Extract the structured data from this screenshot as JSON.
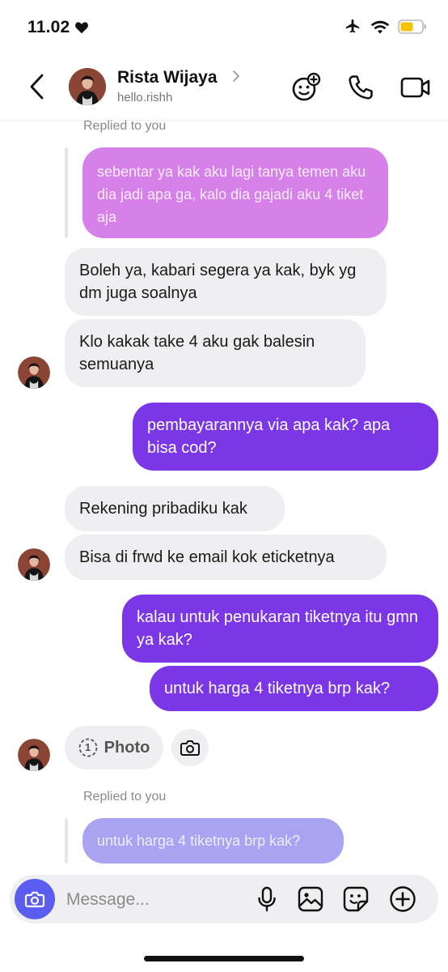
{
  "status_bar": {
    "time": "11.02"
  },
  "header": {
    "name": "Rista Wijaya",
    "handle": "hello.rishh"
  },
  "messages": {
    "reply1_label": "Replied to you",
    "reply1_quote": "sebentar ya kak aku lagi tanya temen aku dia jadi apa ga, kalo dia gajadi aku 4 tiket aja",
    "m1": "Boleh ya, kabari segera ya kak, byk yg dm juga soalnya",
    "m2": "Klo kakak take 4 aku gak balesin semuanya",
    "m3": "pembayarannya via apa kak? apa bisa cod?",
    "m4": "Rekening pribadiku kak",
    "m5": "Bisa di frwd ke email kok eticketnya",
    "m6": "kalau untuk penukaran tiketnya itu gmn ya kak?",
    "m7": "untuk harga 4 tiketnya brp kak?",
    "photo_count": "1",
    "photo_label": "Photo",
    "reply2_label": "Replied to you",
    "reply2_quote": "untuk harga 4 tiketnya brp kak?"
  },
  "composer": {
    "placeholder": "Message..."
  },
  "colors": {
    "outgoing": "#7b36e8",
    "incoming": "#efeff1",
    "quote_pink": "#d681e9",
    "quote_lavender": "#a8a4f2",
    "camera_button": "#5b5cf0",
    "battery": "#f5c400"
  },
  "icons": [
    "heart-icon",
    "airplane-icon",
    "wifi-icon",
    "battery-icon",
    "back-chevron-icon",
    "effects-icon",
    "phone-icon",
    "video-icon",
    "camera-icon",
    "microphone-icon",
    "gallery-icon",
    "sticker-icon",
    "plus-icon"
  ]
}
